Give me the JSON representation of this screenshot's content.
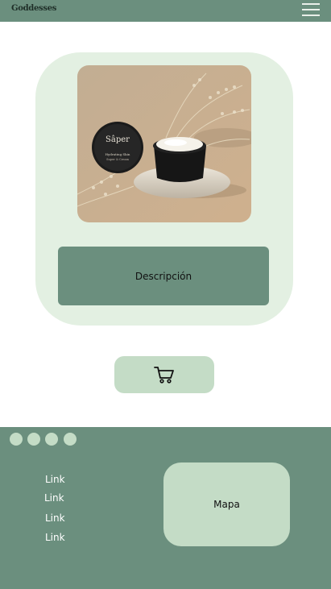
{
  "header": {
    "brand": "Goddesses",
    "menu_icon": "hamburger-menu-icon"
  },
  "product": {
    "image": {
      "jar_brand": "Sâper",
      "jar_line1": "Hydrating Skin",
      "jar_line2": "Super & Cream"
    },
    "description_label": "Descripción",
    "cart_icon": "shopping-cart-icon"
  },
  "footer": {
    "links": [
      "Link",
      "Link",
      "Link",
      "Link"
    ],
    "map_label": "Mapa",
    "social_icons": [
      "social-icon-1",
      "social-icon-2",
      "social-icon-3",
      "social-icon-4"
    ]
  },
  "colors": {
    "primary_green": "#6b8f7e",
    "card_green": "#e3f0e2",
    "button_green": "#c4dcc6"
  }
}
